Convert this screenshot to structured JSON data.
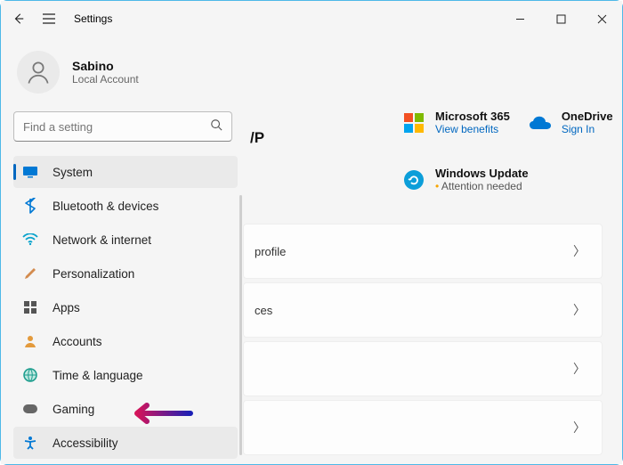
{
  "titlebar": {
    "title": "Settings"
  },
  "profile": {
    "name": "Sabino",
    "sub": "Local Account"
  },
  "search": {
    "placeholder": "Find a setting"
  },
  "sidebar": {
    "items": [
      {
        "label": "System",
        "icon": "monitor-icon",
        "active": true
      },
      {
        "label": "Bluetooth & devices",
        "icon": "bluetooth-icon"
      },
      {
        "label": "Network & internet",
        "icon": "wifi-icon"
      },
      {
        "label": "Personalization",
        "icon": "brush-icon"
      },
      {
        "label": "Apps",
        "icon": "apps-icon"
      },
      {
        "label": "Accounts",
        "icon": "account-icon"
      },
      {
        "label": "Time & language",
        "icon": "globe-icon"
      },
      {
        "label": "Gaming",
        "icon": "gaming-icon"
      },
      {
        "label": "Accessibility",
        "icon": "accessibility-icon",
        "hover": true
      }
    ]
  },
  "main": {
    "partial_heading": "/P",
    "tiles": {
      "ms365": {
        "title": "Microsoft 365",
        "sub": "View benefits"
      },
      "onedrive": {
        "title": "OneDrive",
        "sub": "Sign In"
      },
      "update": {
        "title": "Windows Update",
        "sub": "Attention needed"
      }
    },
    "rows": [
      {
        "label": "profile",
        "partial": true
      },
      {
        "label": "ces",
        "partial": true
      },
      {
        "label": ""
      },
      {
        "label": ""
      }
    ]
  },
  "colors": {
    "accent": "#0067c0"
  }
}
